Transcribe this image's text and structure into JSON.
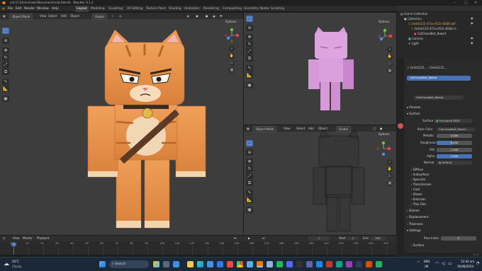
{
  "window": {
    "title": "cat [C:\\Users\\raes\\Documents\\cat.blend] - Blender 3.1.2"
  },
  "menu": {
    "items": [
      "File",
      "Edit",
      "Render",
      "Window",
      "Help"
    ],
    "workspaces": [
      "Layout",
      "Modeling",
      "Sculpting",
      "UV Editing",
      "Texture Paint",
      "Shading",
      "Animation",
      "Rendering",
      "Compositing",
      "Geometry Nodes",
      "Scripting"
    ],
    "active_workspace": "Layout",
    "scene_label": "Scene",
    "view_layer_label": "ViewLayer"
  },
  "viewport_main": {
    "mode": "Object Mode",
    "menus": [
      "View",
      "Select",
      "Add",
      "Object"
    ],
    "transform": "Global",
    "options": "Options"
  },
  "viewport_top_right": {
    "options": "Options"
  },
  "viewport_bottom_right": {
    "mode": "Object Mode",
    "menus": [
      "View",
      "Select",
      "Add",
      "Object"
    ],
    "transform": "Global",
    "options": "Options"
  },
  "outliner": {
    "items": [
      "Scene Collection",
      "Collection",
      "2e4cb122-d71a-452c-82b6-abf",
      "2e4cb122-d71a-452c-82b6-d...",
      "CatChaseBot_Baked",
      "Camera",
      "Light"
    ]
  },
  "properties": {
    "object_name": "2e4cb122...",
    "object_name2": "2e4cb122...",
    "material_slot": "CatChaseBot_Baked",
    "material_name": "CatChaseBot_Baked",
    "sections": {
      "preview": "Preview",
      "surface": "Surface",
      "volume": "Volume",
      "displacement": "Displacement",
      "thickness": "Thickness",
      "settings": "Settings",
      "surface_sub": "Surface"
    },
    "surface_shader": {
      "label": "Surface",
      "value": "Principled BSDF"
    },
    "base_color": {
      "label": "Base Color",
      "value": "CatChaseBot_BaseC..."
    },
    "params": [
      {
        "label": "Metallic",
        "value": "0.000"
      },
      {
        "label": "Roughness",
        "value": "0.450"
      },
      {
        "label": "IOR",
        "value": "1.500"
      },
      {
        "label": "Alpha",
        "value": "1.000"
      },
      {
        "label": "Normal",
        "value": "Default"
      }
    ],
    "subs": [
      "Diffuse",
      "Subsurface",
      "Specular",
      "Transmission",
      "Coat",
      "Sheen",
      "Emission",
      "Thin Film"
    ],
    "pass_index": {
      "label": "Pass Index",
      "value": "0"
    },
    "version": "3.1.2"
  },
  "timeline": {
    "menus": [
      "View",
      "Marker",
      "Playback"
    ],
    "frame_current": "1",
    "start_label": "Start",
    "start": "1",
    "end_label": "End",
    "end": "250",
    "ticks": [
      "0",
      "10",
      "20",
      "30",
      "40",
      "50",
      "60",
      "70",
      "80",
      "90",
      "100",
      "110",
      "120",
      "130",
      "140",
      "150",
      "160",
      "170",
      "180",
      "190",
      "200",
      "210",
      "220",
      "230",
      "240",
      "250"
    ]
  },
  "taskbar": {
    "weather_temp": "26°C",
    "weather_desc": "Cloudy",
    "search": "Search",
    "lang1": "ENG",
    "lang2": "UK",
    "time": "12:42 am",
    "date": "26/08/2024"
  },
  "colors": {
    "accent": "#4772b3",
    "cat_orange": "#e8964a",
    "cat_pink": "#d79ad9"
  }
}
